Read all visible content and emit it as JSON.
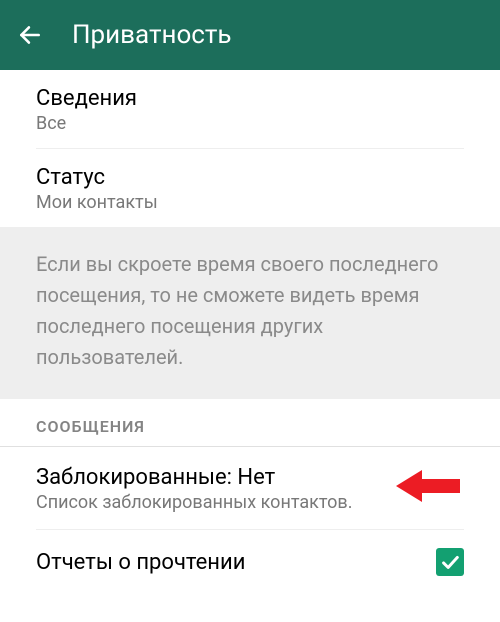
{
  "header": {
    "title": "Приватность"
  },
  "settings": {
    "about": {
      "title": "Сведения",
      "value": "Все"
    },
    "status": {
      "title": "Статус",
      "value": "Мои контакты"
    }
  },
  "info_text": "Если вы скроете время своего последнего посещения, то не сможете видеть время последнего посещения других пользователей.",
  "section_messages": "СООБЩЕНИЯ",
  "blocked": {
    "title": "Заблокированные: Нет",
    "subtitle": "Список заблокированных контактов."
  },
  "read_receipts": {
    "label": "Отчеты о прочтении",
    "checked": true
  },
  "colors": {
    "header_bg": "#1c6e5b",
    "accent": "#13a071",
    "arrow": "#ec1c24"
  }
}
